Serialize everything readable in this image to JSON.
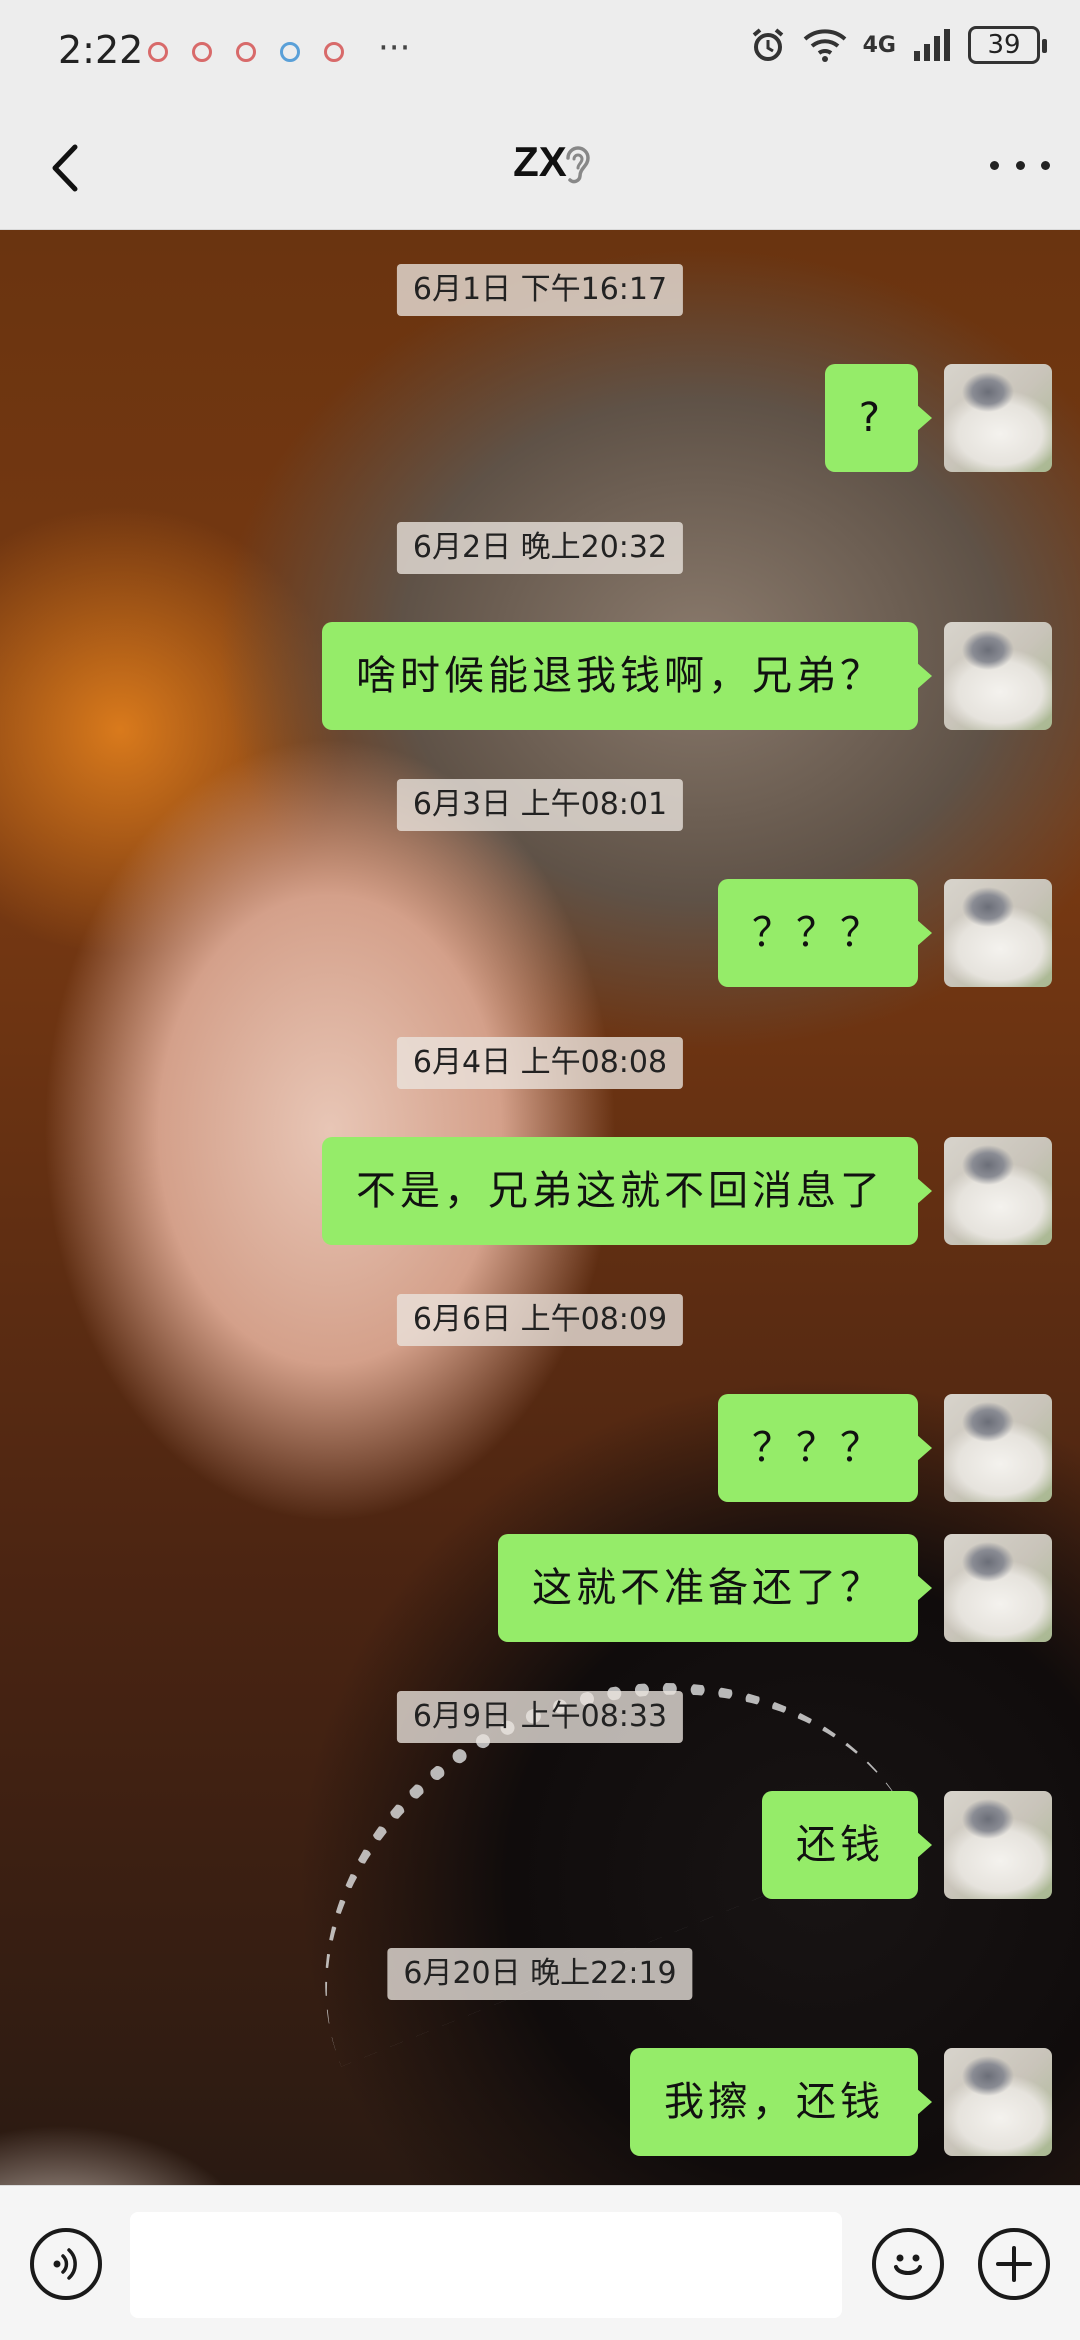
{
  "status_bar": {
    "time": "2:22",
    "more": "···",
    "network": "4G",
    "battery": "39"
  },
  "header": {
    "title": "ZX"
  },
  "messages": [
    {
      "timestamp": "6月1日 下午16:17",
      "texts": [
        "?"
      ]
    },
    {
      "timestamp": "6月2日 晚上20:32",
      "texts": [
        "啥时候能退我钱啊，兄弟？"
      ]
    },
    {
      "timestamp": "6月3日 上午08:01",
      "texts": [
        "？？？"
      ]
    },
    {
      "timestamp": "6月4日 上午08:08",
      "texts": [
        "不是，兄弟这就不回消息了"
      ]
    },
    {
      "timestamp": "6月6日 上午08:09",
      "texts": [
        "？？？",
        "这就不准备还了？"
      ]
    },
    {
      "timestamp": "6月9日 上午08:33",
      "texts": [
        "还钱"
      ]
    },
    {
      "timestamp": "6月20日 晚上22:19",
      "texts": [
        "我擦，还钱"
      ]
    }
  ],
  "input": {
    "placeholder": ""
  },
  "colors": {
    "bubble": "#95ec69",
    "bar_bg": "#ededed"
  }
}
